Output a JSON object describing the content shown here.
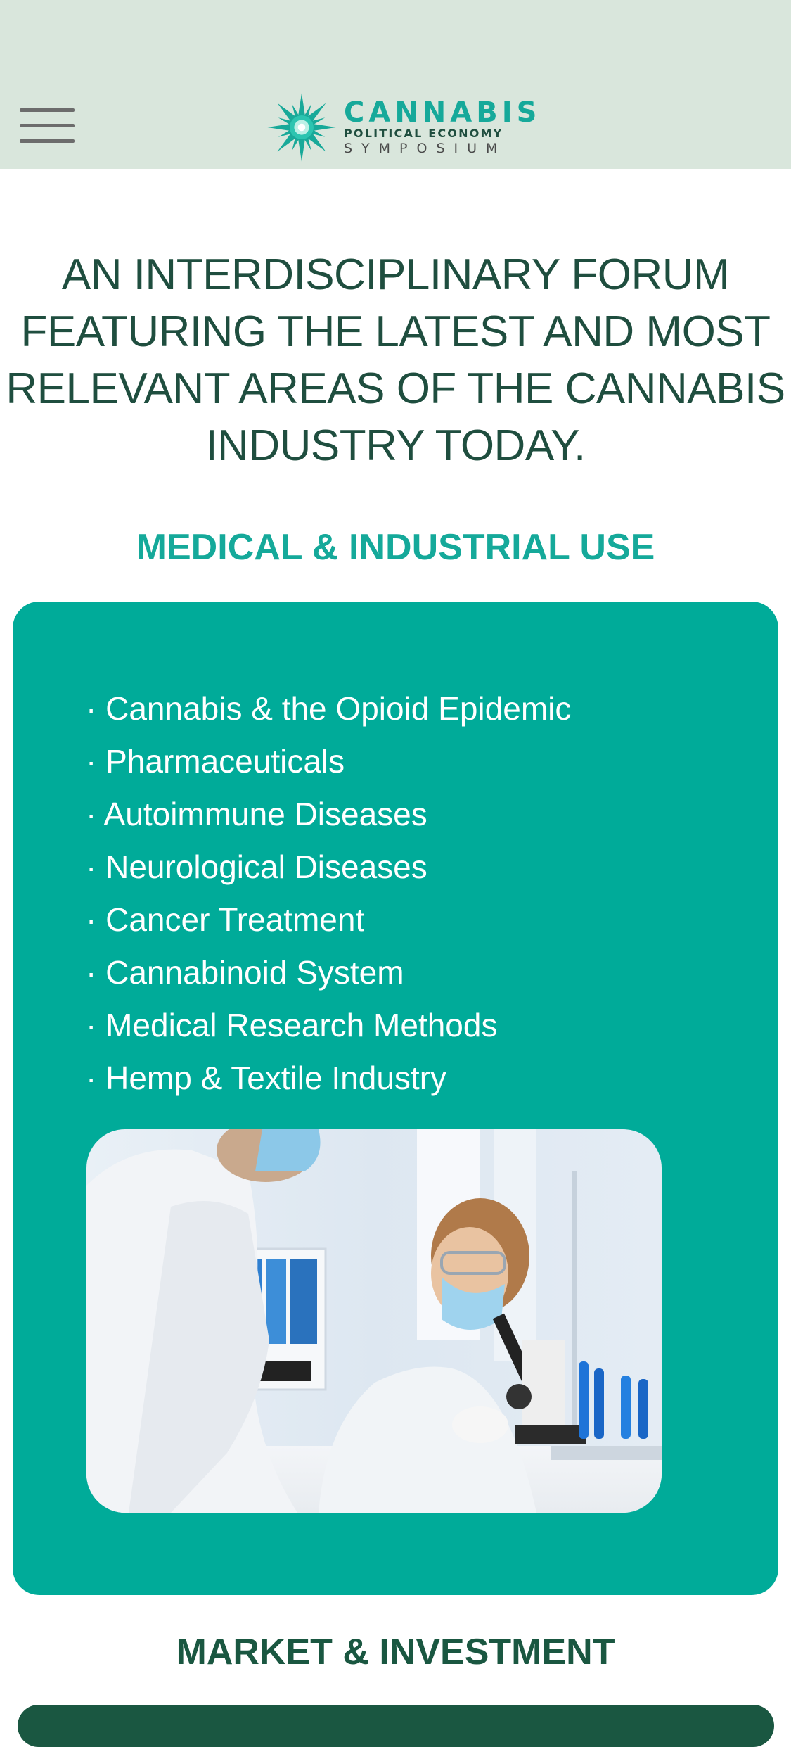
{
  "header": {
    "logo": {
      "line1": "CANNABIS",
      "line2": "POLITICAL ECONOMY",
      "line3": "SYMPOSIUM"
    },
    "menu_icon": "hamburger-menu-icon"
  },
  "tagline": "AN INTERDISCIPLINARY FORUM FEATURING THE LATEST AND MOST RELEVANT AREAS OF THE CANNABIS INDUSTRY TODAY.",
  "sections": [
    {
      "title": "MEDICAL & INDUSTRIAL USE",
      "items": [
        "· Cannabis & the Opioid Epidemic",
        "· Pharmaceuticals",
        "· Autoimmune Diseases",
        "· Neurological Diseases",
        "· Cancer Treatment",
        "· Cannabinoid System",
        "· Medical Research Methods",
        "· Hemp & Textile Industry"
      ],
      "image": "lab-researchers-photo"
    },
    {
      "title": "MARKET & INVESTMENT"
    }
  ],
  "colors": {
    "header_bg": "#d9e6dc",
    "teal": "#00ab99",
    "dark_green": "#1a5741",
    "tagline_text": "#1f4e3f"
  }
}
